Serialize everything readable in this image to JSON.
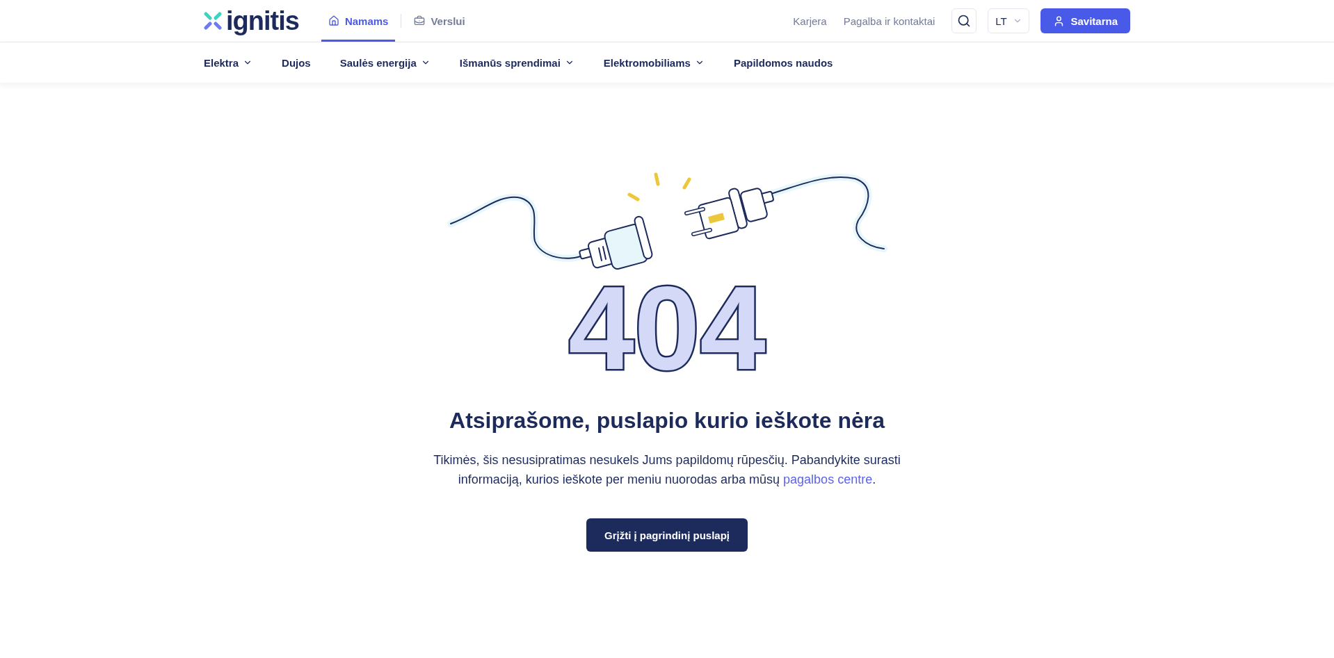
{
  "header": {
    "logo": "ignitis",
    "segments": [
      {
        "label": "Namams",
        "kind": "home",
        "selected": true
      },
      {
        "label": "Verslui",
        "kind": "business",
        "selected": false
      }
    ],
    "links": [
      "Karjera",
      "Pagalba ir kontaktai"
    ],
    "language": "LT",
    "login_button": "Savitarna"
  },
  "nav": [
    {
      "label": "Elektra",
      "has_menu": true
    },
    {
      "label": "Dujos",
      "has_menu": false
    },
    {
      "label": "Saulės energija",
      "has_menu": true
    },
    {
      "label": "Išmanūs sprendimai",
      "has_menu": true
    },
    {
      "label": "Elektromobiliams",
      "has_menu": true
    },
    {
      "label": "Papildomos naudos",
      "has_menu": false
    }
  ],
  "error": {
    "code": "404",
    "title": "Atsiprašome, puslapio kurio ieškote nėra",
    "text": "Tikimės, šis nesusipratimas nesukels Jums papildomų rūpesčių. Pabandykite surasti informaciją, kurios ieškote per meniu nuorodas arba mūsų",
    "link": "pagalbos centre",
    "text_end": ".",
    "button": "Grįžti į pagrindinį puslapį"
  }
}
